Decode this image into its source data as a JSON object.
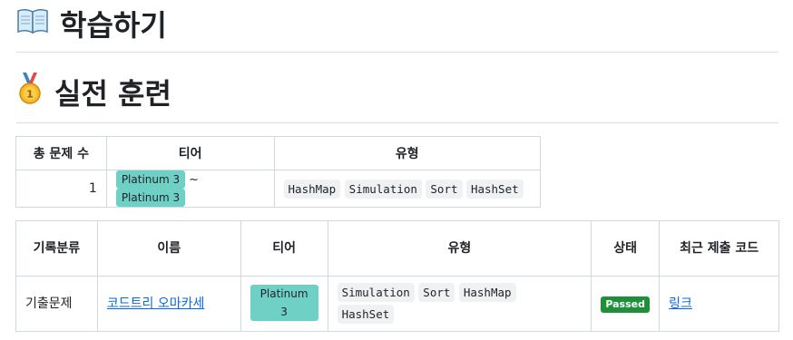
{
  "sections": {
    "learn_title": "학습하기",
    "train_title": "실전 훈련"
  },
  "summary": {
    "headers": {
      "count": "총 문제 수",
      "tier": "티어",
      "types": "유형"
    },
    "count": "1",
    "tier_from": "Platinum 3",
    "tier_sep": "~",
    "tier_to": "Platinum 3",
    "types": [
      "HashMap",
      "Simulation",
      "Sort",
      "HashSet"
    ]
  },
  "records": {
    "headers": {
      "category": "기록분류",
      "name": "이름",
      "tier": "티어",
      "types": "유형",
      "status": "상태",
      "code": "최근 제출 코드"
    },
    "rows": [
      {
        "category": "기출문제",
        "name": "코드트리 오마카세",
        "tier": "Platinum 3",
        "types": [
          "Simulation",
          "Sort",
          "HashMap",
          "HashSet"
        ],
        "status": "Passed",
        "code_link": "링크"
      }
    ]
  },
  "colors": {
    "tier_badge": "#6fd1c6",
    "passed_badge": "#1f8f3a",
    "link": "#0969da",
    "code_bg": "#eff1f3"
  },
  "icons": {
    "learn": "open-book-icon",
    "train": "first-place-medal-icon"
  }
}
